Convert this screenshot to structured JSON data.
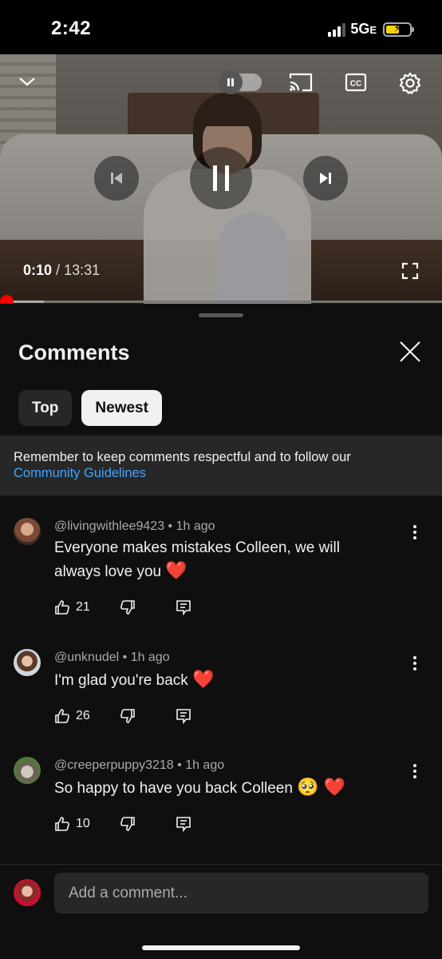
{
  "status_bar": {
    "time": "2:42",
    "network": "5G",
    "network_suffix": "E"
  },
  "player": {
    "current_time": "0:10",
    "separator": "/",
    "duration": "13:31",
    "progress_fraction": 0.0074,
    "buffered_fraction": 0.1,
    "icons": [
      "chevron-down-icon",
      "autoplay-pause-toggle",
      "cast-icon",
      "captions-icon",
      "settings-gear-icon",
      "previous-icon",
      "pause-icon",
      "next-icon",
      "fullscreen-icon"
    ]
  },
  "comments_sheet": {
    "title": "Comments",
    "filters": [
      {
        "label": "Top",
        "selected": false
      },
      {
        "label": "Newest",
        "selected": true
      }
    ],
    "notice": {
      "text": "Remember to keep comments respectful and to follow our",
      "link": "Community Guidelines"
    },
    "comments": [
      {
        "author": "@livingwithlee9423",
        "time": "1h ago",
        "text": "Everyone makes mistakes Colleen, we will always love you",
        "emoji": "❤️",
        "likes": "21"
      },
      {
        "author": "@unknudel",
        "time": "1h ago",
        "text": "I'm glad you're back",
        "emoji": "❤️",
        "likes": "26"
      },
      {
        "author": "@creeperpuppy3218",
        "time": "1h ago",
        "text": "So happy to have you back Colleen",
        "emoji": "🥺 ❤️",
        "likes": "10"
      }
    ],
    "composer": {
      "placeholder": "Add a comment..."
    }
  },
  "colors": {
    "background": "#0f0f0f",
    "surface": "#272727",
    "link": "#3ea6ff",
    "progress": "#ff0000",
    "heart": "#e8182c"
  }
}
